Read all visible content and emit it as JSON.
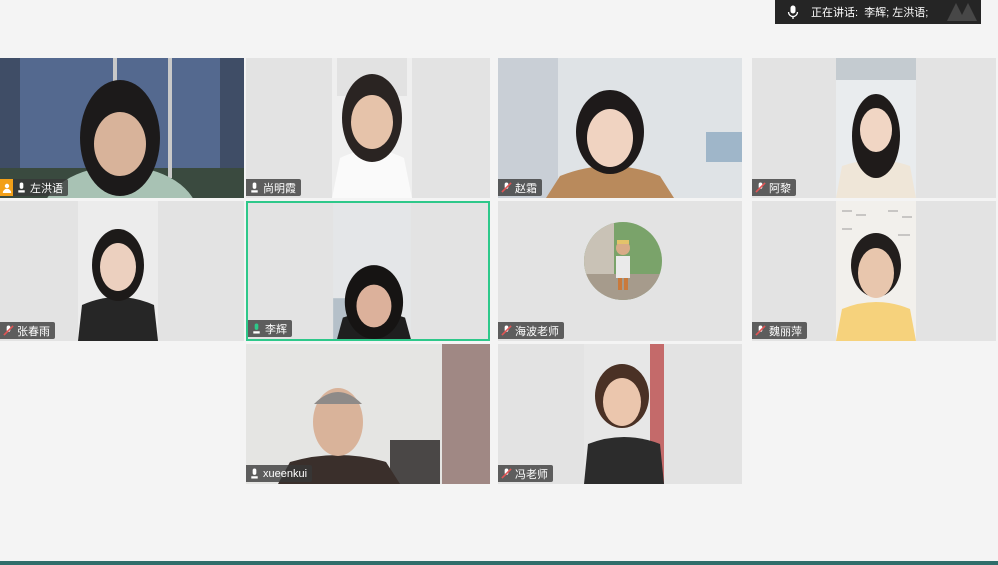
{
  "speaking": {
    "prefix": "正在讲话:",
    "names": "李辉; 左洪语;"
  },
  "tiles": [
    {
      "name": "左洪语",
      "mic": "on",
      "host": true
    },
    {
      "name": "尚明霞",
      "mic": "on"
    },
    {
      "name": "赵霜",
      "mic": "off"
    },
    {
      "name": "阿黎",
      "mic": "off"
    },
    {
      "name": "张春雨",
      "mic": "off"
    },
    {
      "name": "李辉",
      "mic": "speaking",
      "active": true
    },
    {
      "name": "海波老师",
      "mic": "off",
      "avatar": true
    },
    {
      "name": "魏丽萍",
      "mic": "off"
    },
    {
      "name": "xueenkui",
      "mic": "on"
    },
    {
      "name": "冯老师",
      "mic": "off"
    }
  ],
  "colors": {
    "active_border": "#2ec88a",
    "host_badge": "#f2a019",
    "mic_off": "#e25555"
  },
  "icons": {
    "mic_on": "mic-icon",
    "mic_off": "mic-muted-icon",
    "host": "host-person-icon"
  }
}
